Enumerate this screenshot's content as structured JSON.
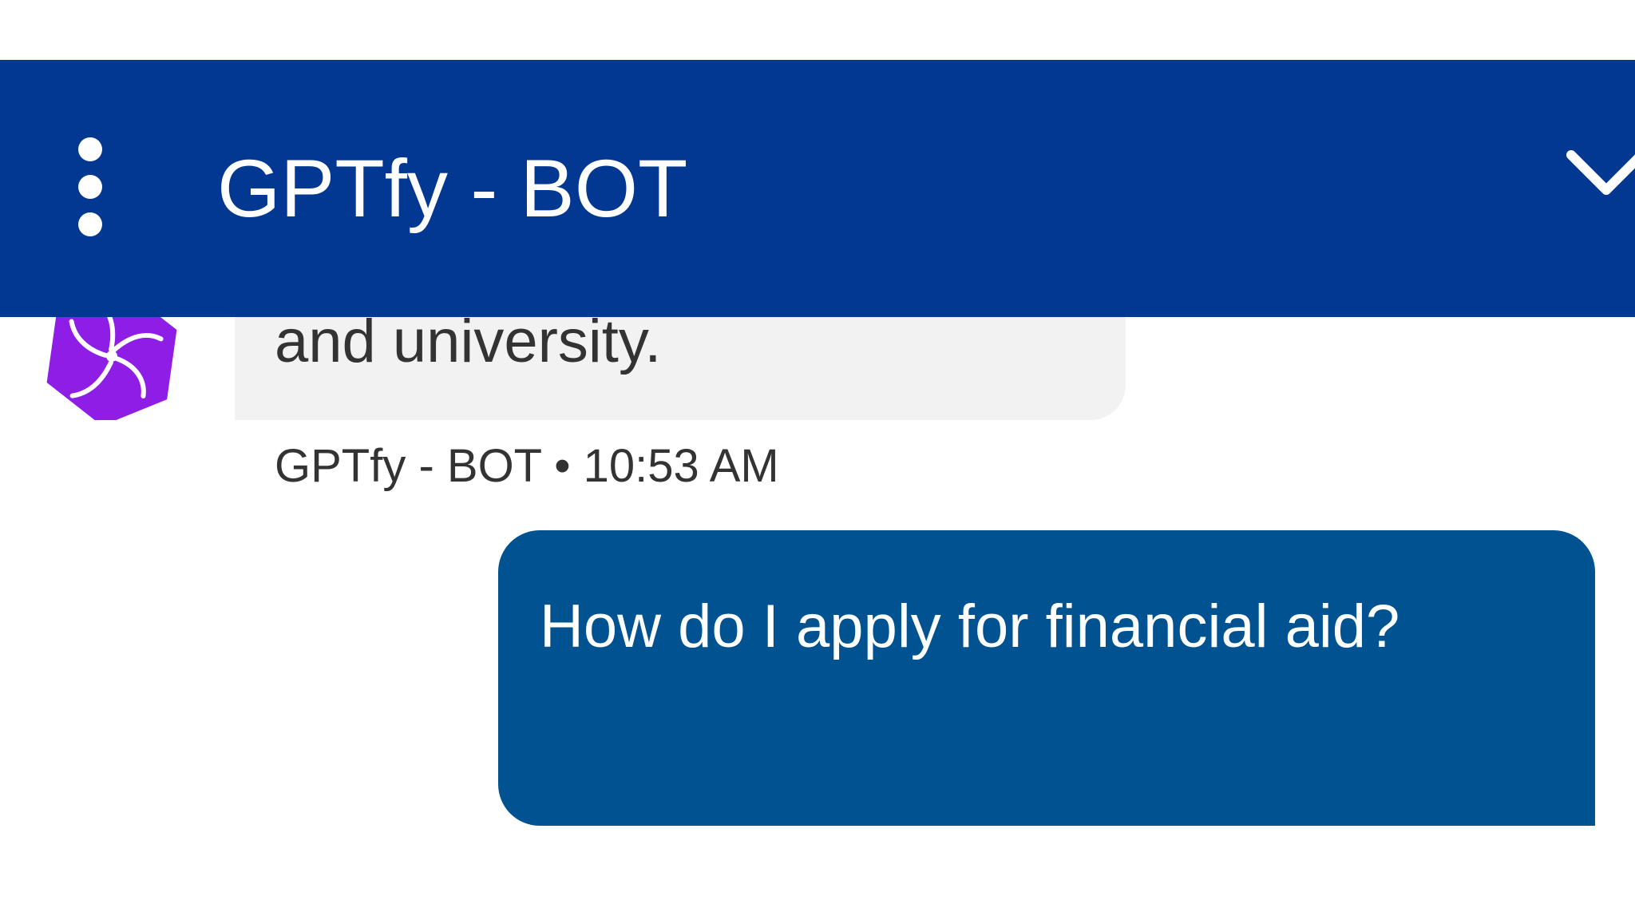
{
  "header": {
    "title": "GPTfy - BOT",
    "menu_icon": "more-vertical-icon",
    "collapse_icon": "chevron-down-icon",
    "background_color": "#023891"
  },
  "messages": {
    "bot": {
      "text": "and university.",
      "sender": "GPTfy - BOT",
      "separator": "•",
      "time": "10:53 AM",
      "avatar_icon": "bot-avatar-icon",
      "avatar_color": "#8e1ee6",
      "bubble_color": "#f2f2f2"
    },
    "user": {
      "text": "How do I apply for financial aid?",
      "bubble_color": "#005290"
    }
  }
}
